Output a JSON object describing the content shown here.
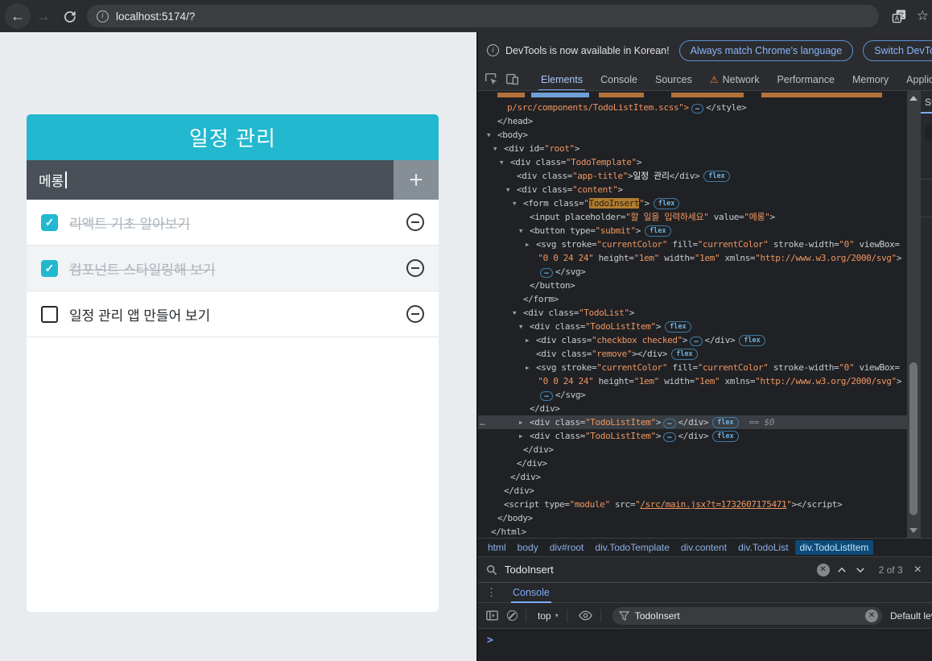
{
  "browser": {
    "url": "localhost:5174/?"
  },
  "todo_app": {
    "title": "일정 관리",
    "insert": {
      "value": "메롱",
      "add_label": "+"
    },
    "items": [
      {
        "text": "리액트 기초 알아보기",
        "checked": true
      },
      {
        "text": "컴포넌트 스타일링해 보기",
        "checked": true
      },
      {
        "text": "일정 관리 앱 만들어 보기",
        "checked": false
      }
    ]
  },
  "colors": {
    "accent_teal": "#22b8cf",
    "insert_bg": "#495057",
    "add_btn": "#868e96",
    "devtools_value_orange": "#ef9662",
    "search_highlight": "#b07d2e",
    "crumb_selected_bg": "#0e4a77"
  },
  "devtools": {
    "notification": {
      "message": "DevTools is now available in Korean!",
      "actions": [
        "Always match Chrome's language",
        "Switch DevTools to Korean"
      ]
    },
    "tabs": [
      {
        "label": "Elements",
        "selected": true
      },
      {
        "label": "Console"
      },
      {
        "label": "Sources"
      },
      {
        "label": "Network",
        "warning": true
      },
      {
        "label": "Performance"
      },
      {
        "label": "Memory"
      },
      {
        "label": "Application"
      }
    ],
    "styles_sidebar_label": "Styles",
    "elements_tree": [
      {
        "i": 2.5,
        "s": [
          [
            "o",
            "p/src/components/TodoListItem.scss\">"
          ],
          [
            "e",
            "…"
          ],
          [
            "g",
            "</style>"
          ]
        ]
      },
      {
        "i": 1,
        "s": [
          [
            "g",
            "</head>"
          ]
        ]
      },
      {
        "i": 1,
        "a": "d",
        "s": [
          [
            "g",
            "<body>"
          ]
        ]
      },
      {
        "i": 2,
        "a": "d",
        "s": [
          [
            "g",
            "<div id="
          ],
          [
            "o",
            "\"root\""
          ],
          [
            "g",
            ">"
          ]
        ]
      },
      {
        "i": 3,
        "a": "d",
        "s": [
          [
            "g",
            "<div class="
          ],
          [
            "o",
            "\"TodoTemplate\""
          ],
          [
            "g",
            ">"
          ]
        ]
      },
      {
        "i": 4,
        "s": [
          [
            "g",
            "<div class="
          ],
          [
            "o",
            "\"app-title\""
          ],
          [
            "g",
            ">"
          ],
          [
            "w",
            "일정 관리"
          ],
          [
            "g",
            "</div>"
          ],
          [
            "b",
            "flex"
          ]
        ]
      },
      {
        "i": 4,
        "a": "d",
        "s": [
          [
            "g",
            "<div class="
          ],
          [
            "o",
            "\"content\""
          ],
          [
            "g",
            ">"
          ]
        ]
      },
      {
        "i": 5,
        "a": "d",
        "s": [
          [
            "g",
            "<form class="
          ],
          [
            "o",
            "\""
          ],
          [
            "h",
            "TodoInsert"
          ],
          [
            "o",
            "\""
          ],
          [
            "g",
            ">"
          ],
          [
            "b",
            "flex"
          ]
        ]
      },
      {
        "i": 6,
        "s": [
          [
            "g",
            "<input placeholder="
          ],
          [
            "o",
            "\"할 일을 입력하세요\""
          ],
          [
            "g",
            " value="
          ],
          [
            "o",
            "\"메롱\""
          ],
          [
            "g",
            ">"
          ]
        ]
      },
      {
        "i": 6,
        "a": "d",
        "s": [
          [
            "g",
            "<button type="
          ],
          [
            "o",
            "\"submit\""
          ],
          [
            "g",
            ">"
          ],
          [
            "b",
            "flex"
          ]
        ]
      },
      {
        "i": 7,
        "a": "r",
        "s": [
          [
            "g",
            "<svg stroke="
          ],
          [
            "o",
            "\"currentColor\""
          ],
          [
            "g",
            " fill="
          ],
          [
            "o",
            "\"currentColor\""
          ],
          [
            "g",
            " stroke-width="
          ],
          [
            "o",
            "\"0\""
          ],
          [
            "g",
            " viewBox="
          ]
        ]
      },
      {
        "i": 7.3,
        "s": [
          [
            "o",
            "\"0 0 24 24\""
          ],
          [
            "g",
            " height="
          ],
          [
            "o",
            "\"1em\""
          ],
          [
            "g",
            " width="
          ],
          [
            "o",
            "\"1em\""
          ],
          [
            "g",
            " xmlns="
          ],
          [
            "o",
            "\"http://www.w3.org/2000/svg\""
          ],
          [
            "g",
            ">"
          ]
        ]
      },
      {
        "i": 7.3,
        "s": [
          [
            "e",
            "…"
          ],
          [
            "g",
            "</svg>"
          ]
        ]
      },
      {
        "i": 6,
        "s": [
          [
            "g",
            "</button>"
          ]
        ]
      },
      {
        "i": 5,
        "s": [
          [
            "g",
            "</form>"
          ]
        ]
      },
      {
        "i": 5,
        "a": "d",
        "s": [
          [
            "g",
            "<div class="
          ],
          [
            "o",
            "\"TodoList\""
          ],
          [
            "g",
            ">"
          ]
        ]
      },
      {
        "i": 6,
        "a": "d",
        "s": [
          [
            "g",
            "<div class="
          ],
          [
            "o",
            "\"TodoListItem\""
          ],
          [
            "g",
            ">"
          ],
          [
            "b",
            "flex"
          ]
        ]
      },
      {
        "i": 7,
        "a": "r",
        "s": [
          [
            "g",
            "<div class="
          ],
          [
            "o",
            "\"checkbox checked\""
          ],
          [
            "g",
            ">"
          ],
          [
            "e",
            "…"
          ],
          [
            "g",
            "</div>"
          ],
          [
            "b",
            "flex"
          ]
        ]
      },
      {
        "i": 7,
        "s": [
          [
            "g",
            "<div class="
          ],
          [
            "o",
            "\"remove\""
          ],
          [
            "g",
            "></div>"
          ],
          [
            "b",
            "flex"
          ]
        ]
      },
      {
        "i": 7,
        "a": "r",
        "s": [
          [
            "g",
            "<svg stroke="
          ],
          [
            "o",
            "\"currentColor\""
          ],
          [
            "g",
            " fill="
          ],
          [
            "o",
            "\"currentColor\""
          ],
          [
            "g",
            " stroke-width="
          ],
          [
            "o",
            "\"0\""
          ],
          [
            "g",
            " viewBox="
          ]
        ]
      },
      {
        "i": 7.3,
        "s": [
          [
            "o",
            "\"0 0 24 24\""
          ],
          [
            "g",
            " height="
          ],
          [
            "o",
            "\"1em\""
          ],
          [
            "g",
            " width="
          ],
          [
            "o",
            "\"1em\""
          ],
          [
            "g",
            " xmlns="
          ],
          [
            "o",
            "\"http://www.w3.org/2000/svg\""
          ],
          [
            "g",
            ">"
          ]
        ]
      },
      {
        "i": 7.3,
        "s": [
          [
            "e",
            "…"
          ],
          [
            "g",
            "</svg>"
          ]
        ]
      },
      {
        "i": 6,
        "s": [
          [
            "g",
            "</div>"
          ]
        ]
      },
      {
        "i": 6,
        "a": "r",
        "sel": true,
        "s": [
          [
            "g",
            "<div class="
          ],
          [
            "o",
            "\"TodoListItem\""
          ],
          [
            "g",
            ">"
          ],
          [
            "e",
            "…"
          ],
          [
            "g",
            "</div>"
          ],
          [
            "b",
            "flex"
          ],
          [
            "q",
            "== $0"
          ]
        ]
      },
      {
        "i": 6,
        "a": "r",
        "s": [
          [
            "g",
            "<div class="
          ],
          [
            "o",
            "\"TodoListItem\""
          ],
          [
            "g",
            ">"
          ],
          [
            "e",
            "…"
          ],
          [
            "g",
            "</div>"
          ],
          [
            "b",
            "flex"
          ]
        ]
      },
      {
        "i": 5,
        "s": [
          [
            "g",
            "</div>"
          ]
        ]
      },
      {
        "i": 4,
        "s": [
          [
            "g",
            "</div>"
          ]
        ]
      },
      {
        "i": 3,
        "s": [
          [
            "g",
            "</div>"
          ]
        ]
      },
      {
        "i": 2,
        "s": [
          [
            "g",
            "</div>"
          ]
        ]
      },
      {
        "i": 2,
        "s": [
          [
            "g",
            "<script type="
          ],
          [
            "o",
            "\"module\""
          ],
          [
            "g",
            " src="
          ],
          [
            "o",
            "\""
          ],
          [
            "l",
            "/src/main.jsx?t=1732607175471"
          ],
          [
            "o",
            "\""
          ],
          [
            "g",
            "></script>"
          ]
        ]
      },
      {
        "i": 1,
        "s": [
          [
            "g",
            "</body>"
          ]
        ]
      },
      {
        "i": 0,
        "s": [
          [
            "g",
            "</html>"
          ]
        ]
      }
    ],
    "breadcrumbs": [
      {
        "label": "html"
      },
      {
        "label": "body"
      },
      {
        "label": "div#root"
      },
      {
        "label": "div.TodoTemplate"
      },
      {
        "label": "div.content"
      },
      {
        "label": "div.TodoList"
      },
      {
        "label": "div.TodoListItem",
        "selected": true
      }
    ],
    "search": {
      "query": "TodoInsert",
      "results": "2 of 3"
    },
    "console": {
      "tab": "Console",
      "context": "top",
      "filter": "TodoInsert",
      "levels": "Default levels"
    }
  }
}
